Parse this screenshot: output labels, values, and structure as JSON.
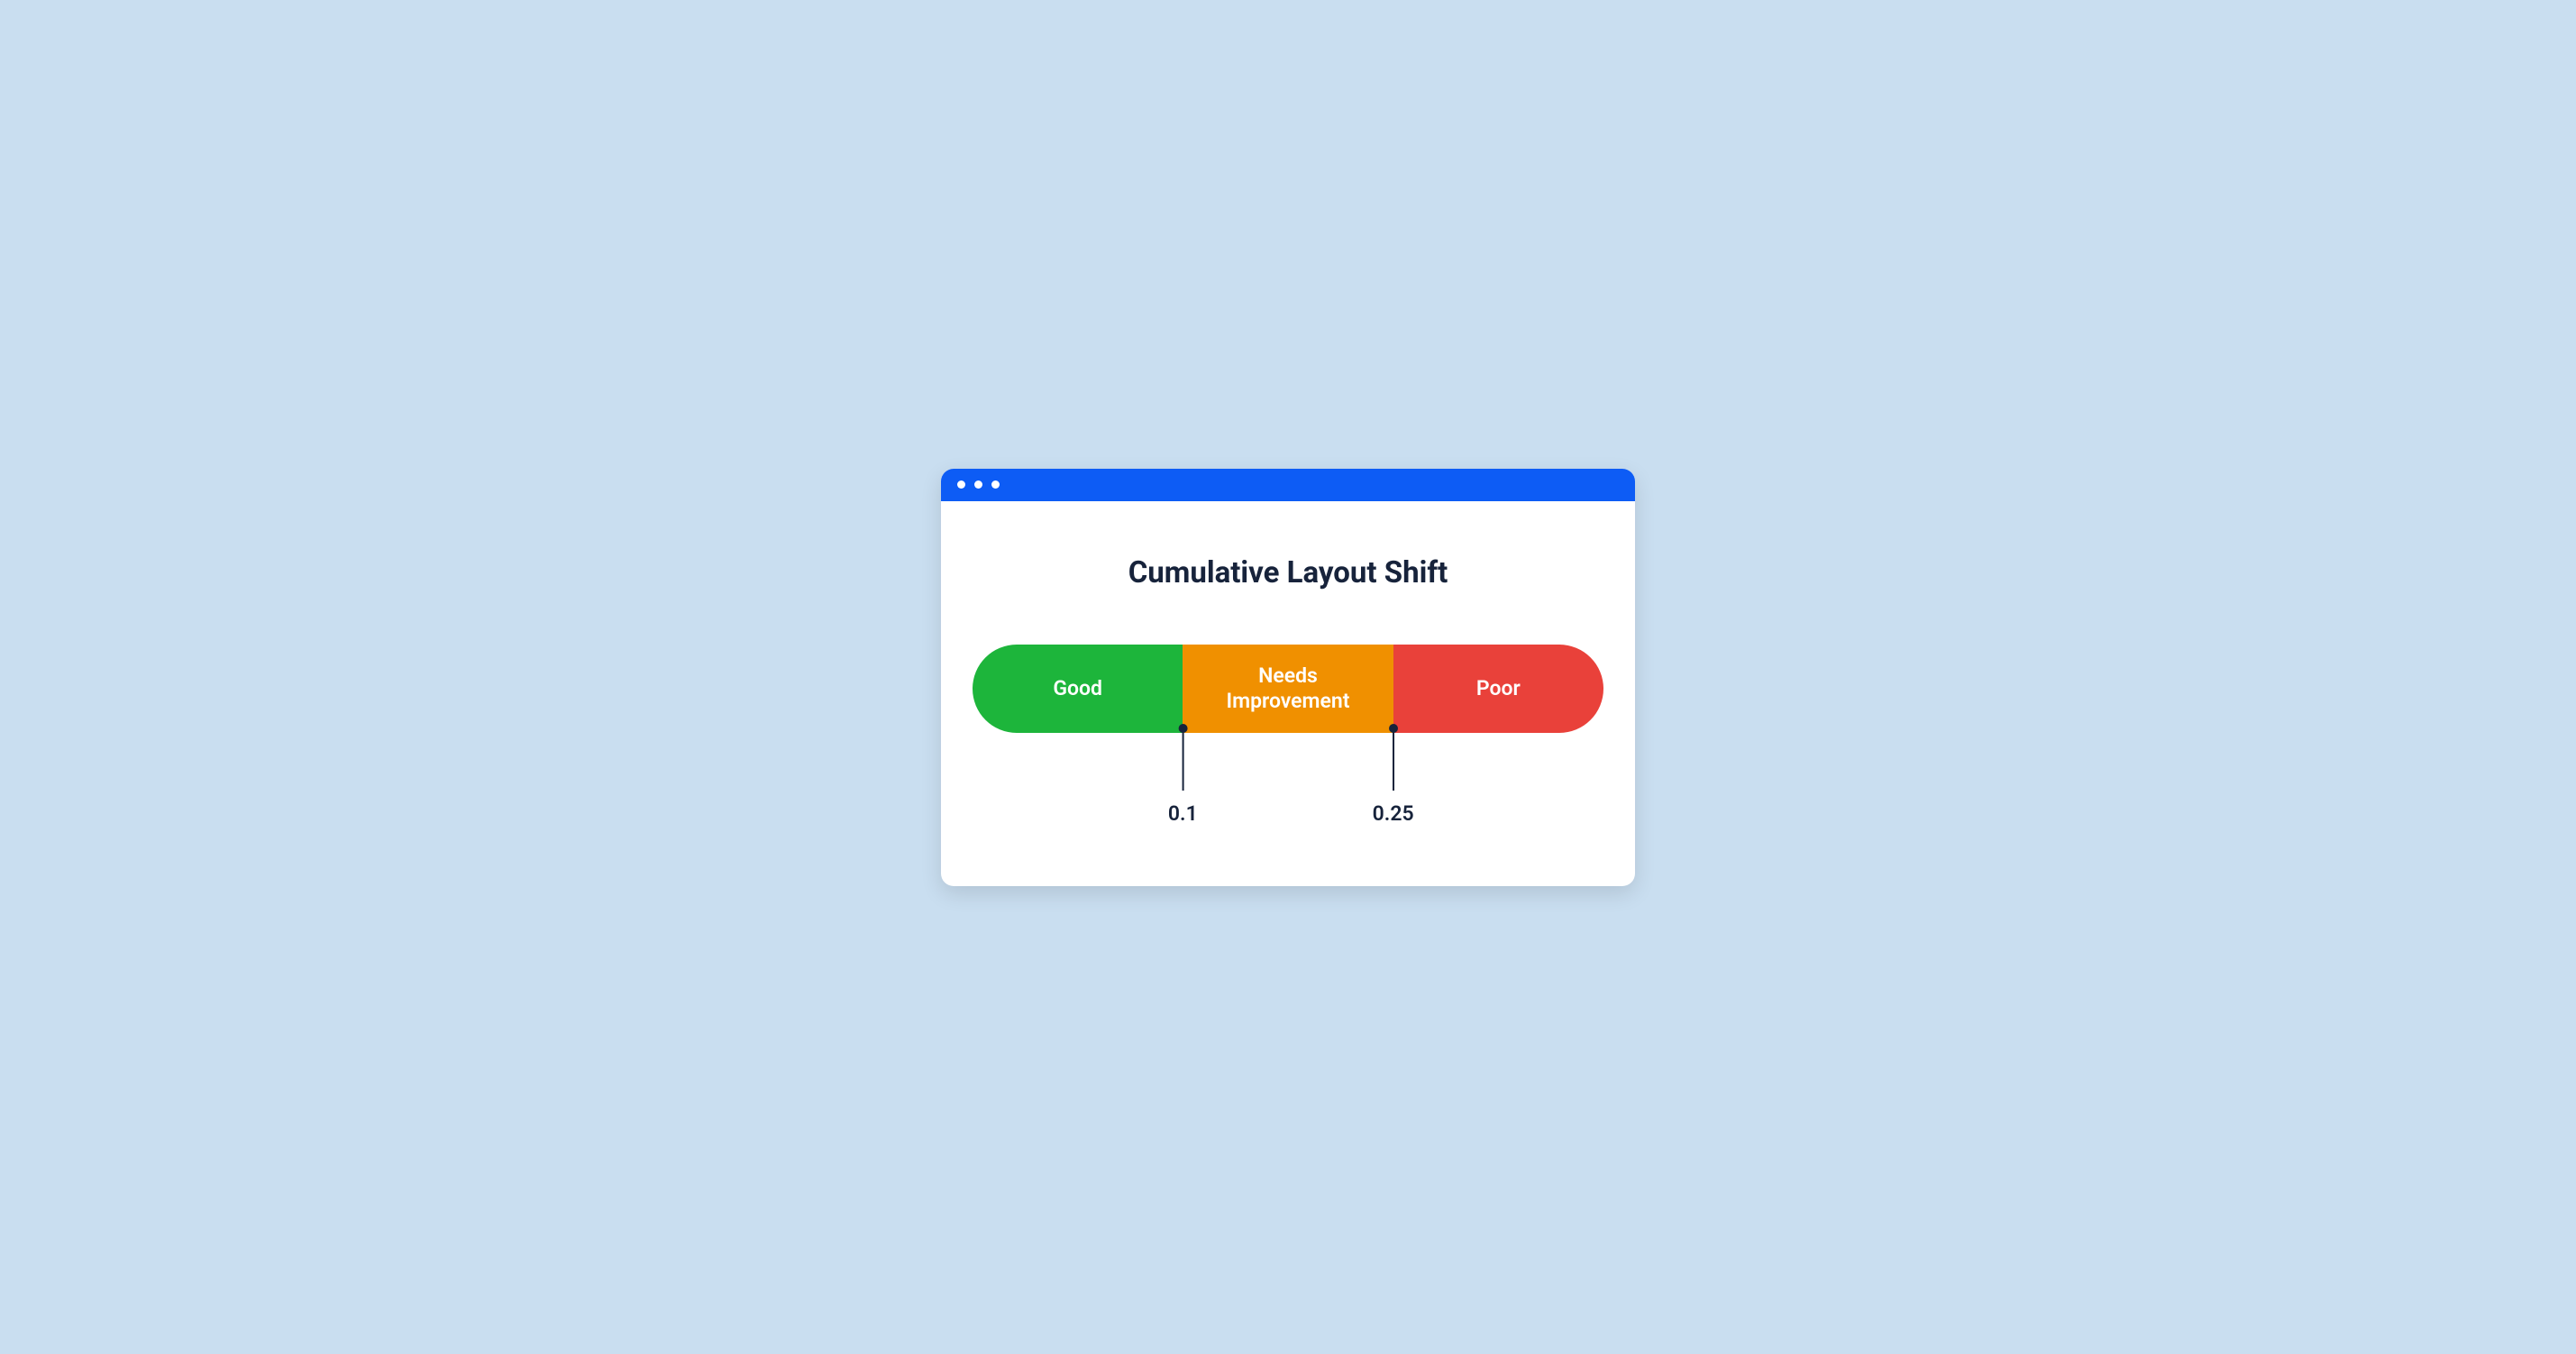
{
  "title": "Cumulative Layout Shift",
  "segments": {
    "good": "Good",
    "needs": "Needs\nImprovement",
    "poor": "Poor"
  },
  "thresholds": {
    "first": "0.1",
    "second": "0.25"
  },
  "chart_data": {
    "type": "bar",
    "title": "Cumulative Layout Shift",
    "categories": [
      "Good",
      "Needs Improvement",
      "Poor"
    ],
    "thresholds": [
      0.1,
      0.25
    ],
    "colors": {
      "good": "#1db53b",
      "needs": "#f09000",
      "poor": "#e9413a"
    },
    "ranges": [
      {
        "label": "Good",
        "min": 0,
        "max": 0.1
      },
      {
        "label": "Needs Improvement",
        "min": 0.1,
        "max": 0.25
      },
      {
        "label": "Poor",
        "min": 0.25,
        "max": null
      }
    ]
  }
}
